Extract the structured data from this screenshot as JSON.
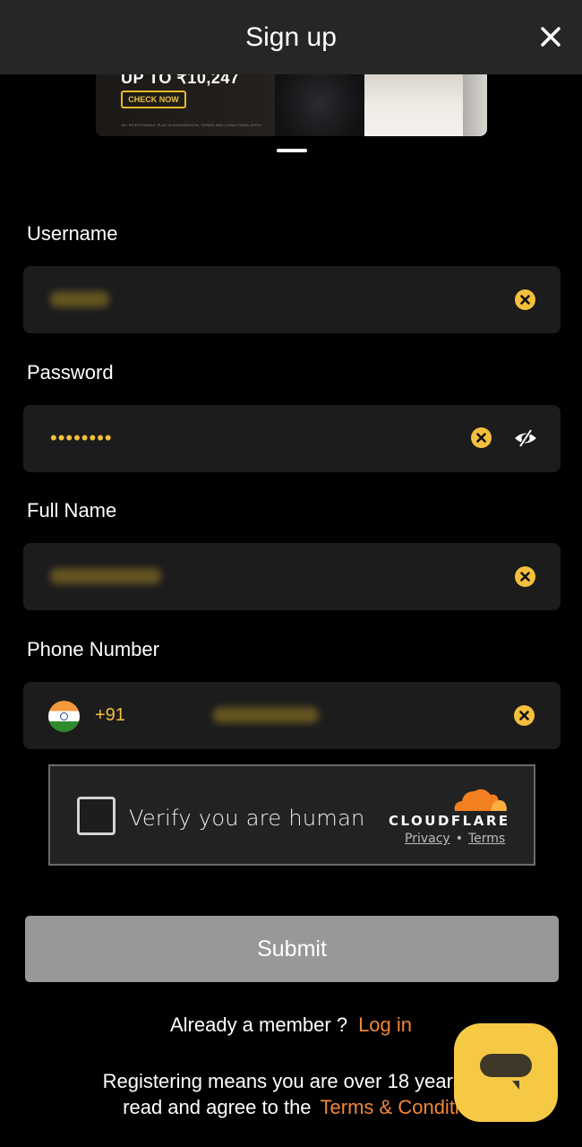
{
  "header": {
    "title": "Sign up",
    "close_icon": "close-icon"
  },
  "banner": {
    "headline": "UP TO ₹10,247",
    "cta_label": "CHECK NOW",
    "disclaimer": "18+ RESPONSIBLE PLAY IN MODERATION. TERMS AND CONDITIONS APPLY.",
    "accent_color": "#e8b92c"
  },
  "form": {
    "username": {
      "label": "Username",
      "value": "[blurred]"
    },
    "password": {
      "label": "Password",
      "masked_value": "••••••••"
    },
    "full_name": {
      "label": "Full Name",
      "value": "[blurred]"
    },
    "phone": {
      "label": "Phone Number",
      "country": "India",
      "dial_code": "+91",
      "value": "[blurred]"
    }
  },
  "captcha": {
    "label": "Verify you are human",
    "brand": "CLOUDFLARE",
    "privacy_link": "Privacy",
    "separator": "•",
    "terms_link": "Terms"
  },
  "submit_label": "Submit",
  "login_prompt": {
    "text": "Already a member ?",
    "link": "Log in"
  },
  "legal": {
    "line1": "Registering means you are over 18 years o",
    "line2": "read and agree to the",
    "link": "Terms & Conditi"
  },
  "colors": {
    "accent_yellow": "#f4bf3c",
    "link_orange": "#f0873a",
    "field_bg": "#1c1c1c",
    "header_bg": "#262626",
    "submit_bg": "#989898"
  }
}
